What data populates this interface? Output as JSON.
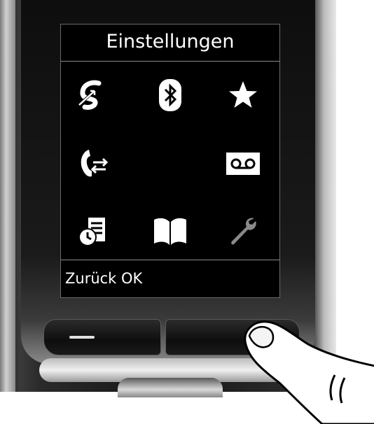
{
  "screen": {
    "title": "Einstellungen",
    "softkeys_label": "Zurück OK"
  },
  "menu_icons": [
    {
      "name": "sync-icon"
    },
    {
      "name": "bluetooth-icon"
    },
    {
      "name": "star-icon"
    },
    {
      "name": "call-forward-icon"
    },
    {
      "name": "voicemail-icon"
    },
    {
      "name": "clock-list-icon"
    },
    {
      "name": "book-icon"
    },
    {
      "name": "wrench-icon"
    }
  ],
  "colors": {
    "screen_bg": "#000000",
    "text": "#ffffff",
    "selected_icon": "#8a8a8a"
  }
}
